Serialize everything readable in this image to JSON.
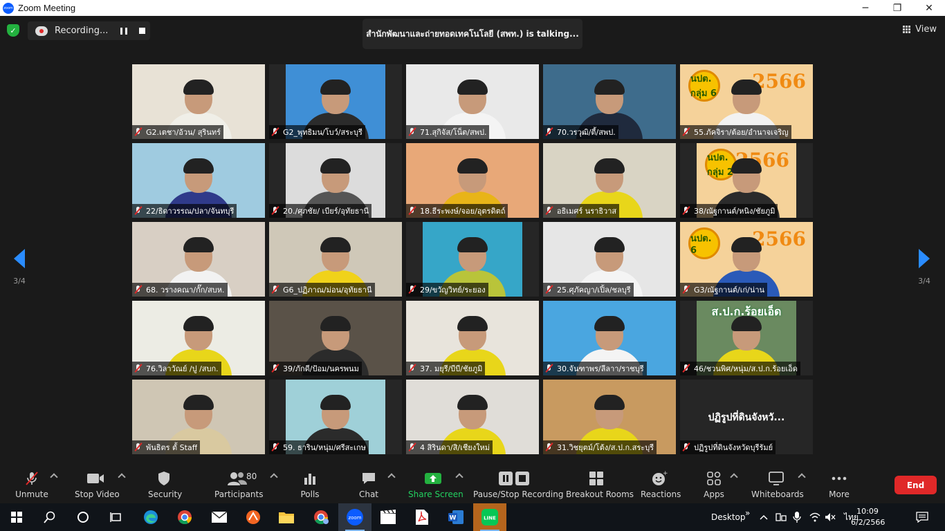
{
  "window": {
    "title": "Zoom Meeting",
    "controls": {
      "minimize": "─",
      "maximize": "❐",
      "close": "✕"
    }
  },
  "top": {
    "recording_label": "Recording...",
    "talking_text": "สำนักพัฒนาและถ่ายทอดเทคโนโลยี (สพท.) is  talking...",
    "view_label": "View"
  },
  "pagination": {
    "current": "3/4"
  },
  "participants": [
    {
      "name": "G2.เตชา/อ้วน/ สุรินทร์",
      "bg": "#e8e2d6",
      "shirt": "#f0efe8",
      "narrow": false
    },
    {
      "name": "G2_พุทธิมน/โบว์/สระบุรี",
      "bg": "#3f8fd6",
      "shirt": "#2b2b2b",
      "narrow": true
    },
    {
      "name": "71.สุกิจัส/โน็ต/สพป.",
      "bg": "#e9e9e9",
      "shirt": "#f4f4f4",
      "narrow": false
    },
    {
      "name": "70.วรวุฒิ/ตี้/สพป.",
      "bg": "#3e6c8c",
      "shirt": "#1f2a3d",
      "narrow": false
    },
    {
      "name": "55.ภัคจิรา/ต้อย/อำนาจเจริญ",
      "bg": "#f5d29a",
      "shirt": "#f2f2f2",
      "narrow": false,
      "banner": "2566",
      "badge": "นปต. กลุ่ม 6"
    },
    {
      "name": "22/ธิดาวรรณ/ปลา/จันทบุรี",
      "bg": "#9fcbe0",
      "shirt": "#2f3a8a",
      "narrow": false
    },
    {
      "name": "20./ศุภชัย/ เบียร์/อุทัยธานี",
      "bg": "#dcdcdc",
      "shirt": "#555555",
      "narrow": true
    },
    {
      "name": "18.ธีระพงษ์/จอย/อุตรดิตถ์",
      "bg": "#e8a878",
      "shirt": "#e8b418",
      "narrow": false
    },
    {
      "name": "อธิเมศร์ นราธิวาส",
      "bg": "#d9d4c4",
      "shirt": "#e8d61a",
      "narrow": false
    },
    {
      "name": "38/ณัฐกานต์/หนิง/ชัยภูมิ",
      "bg": "#f5d29a",
      "shirt": "#2b2b2b",
      "narrow": true,
      "banner": "2566",
      "badge": "นปต. กลุ่ม 2"
    },
    {
      "name": "68. วรางคณา/กั๊ก/สบห.",
      "bg": "#d8cfc4",
      "shirt": "#f2f2f2",
      "narrow": false
    },
    {
      "name": "G6_ปฏิภาณ/ม่อน/อุทัยธานี",
      "bg": "#cfc8b8",
      "shirt": "#f0d21a",
      "narrow": false
    },
    {
      "name": "29/ขวัญวิทย์/ระยอง",
      "bg": "#36a6c8",
      "shirt": "#b9c43a",
      "narrow": true
    },
    {
      "name": "25.ศุภัคญา/เปิ้ล/ชลบุรี",
      "bg": "#e6e6e6",
      "shirt": "#f4f4f4",
      "narrow": false
    },
    {
      "name": "G3/ณัฐกานต์/เก่/น่าน",
      "bg": "#f5d29a",
      "shirt": "#2a5ab8",
      "narrow": false,
      "banner": "2566",
      "badge": "นปต. 6"
    },
    {
      "name": "76.วิลาวัณย์ /ปู /สบก.",
      "bg": "#ecece4",
      "shirt": "#e8d61a",
      "narrow": false
    },
    {
      "name": "39/ภักดี/ป้อม/นครพนม",
      "bg": "#5a5248",
      "shirt": "#2b2b2b",
      "narrow": false
    },
    {
      "name": "37. มยุรี/บีบี/ชัยภูมิ",
      "bg": "#e8e4dc",
      "shirt": "#e8d61a",
      "narrow": false
    },
    {
      "name": "30.จันฑาพร/ลีลาา/ราชบุรี",
      "bg": "#4aa6e0",
      "shirt": "#f4f4f4",
      "narrow": false
    },
    {
      "name": "46/ชวนพิศ/หนุ่ม/ส.ป.ก.ร้อยเอ็ด",
      "bg": "#6a8a60",
      "shirt": "#e8d61a",
      "narrow": true,
      "sign": "ส.ป.ก.ร้อยเอ็ด"
    },
    {
      "name": "พันธิตร ตั้ Staff",
      "bg": "#cfc6b4",
      "shirt": "#d9c9a0",
      "narrow": false
    },
    {
      "name": "59. ธาริน/หนุ่ม/ศรีสะเกษ",
      "bg": "#9fd0d8",
      "shirt": "#2b2b2b",
      "narrow": true
    },
    {
      "name": "4 สิรินดา/สิ/เชียงใหม่",
      "bg": "#e0ddd8",
      "shirt": "#e8d61a",
      "narrow": false
    },
    {
      "name": "31.วิชยุตม์/โต้ง/ส.ป.ก.สระบุรี",
      "bg": "#c89a60",
      "shirt": "#e8d61a",
      "narrow": false
    },
    {
      "name": "ปฏิรูปที่ดินจังหวัดบุรีรัมย์",
      "bg": "#262626",
      "narrow": false,
      "text_only": true,
      "short": "ปฏิรูปที่ดินจังหวั..."
    }
  ],
  "toolbar": {
    "unmute": "Unmute",
    "stop_video": "Stop Video",
    "security": "Security",
    "participants": "Participants",
    "participants_count": "80",
    "polls": "Polls",
    "chat": "Chat",
    "share_screen": "Share Screen",
    "pause_stop_recording": "Pause/Stop Recording",
    "breakout_rooms": "Breakout Rooms",
    "reactions": "Reactions",
    "apps": "Apps",
    "whiteboards": "Whiteboards",
    "more": "More",
    "end": "End"
  },
  "taskbar": {
    "apps": [
      "start-icon",
      "search-icon",
      "cortana-icon",
      "task-view-icon",
      "edge-icon",
      "chrome-icon",
      "mail-icon",
      "app-orange-icon",
      "file-explorer-icon",
      "chrome-profile-icon",
      "zoom-icon",
      "video-editor-icon",
      "pdf-icon",
      "word-icon",
      "line-icon"
    ],
    "desktop_label": "Desktop",
    "lang": "ไทย",
    "time": "10:09",
    "date": "6/2/2566",
    "overflow": "»"
  },
  "colors": {
    "accent_blue": "#2a8cff",
    "end_red": "#e02828",
    "share_green": "#23d160",
    "bg": "#1a1a1a"
  }
}
